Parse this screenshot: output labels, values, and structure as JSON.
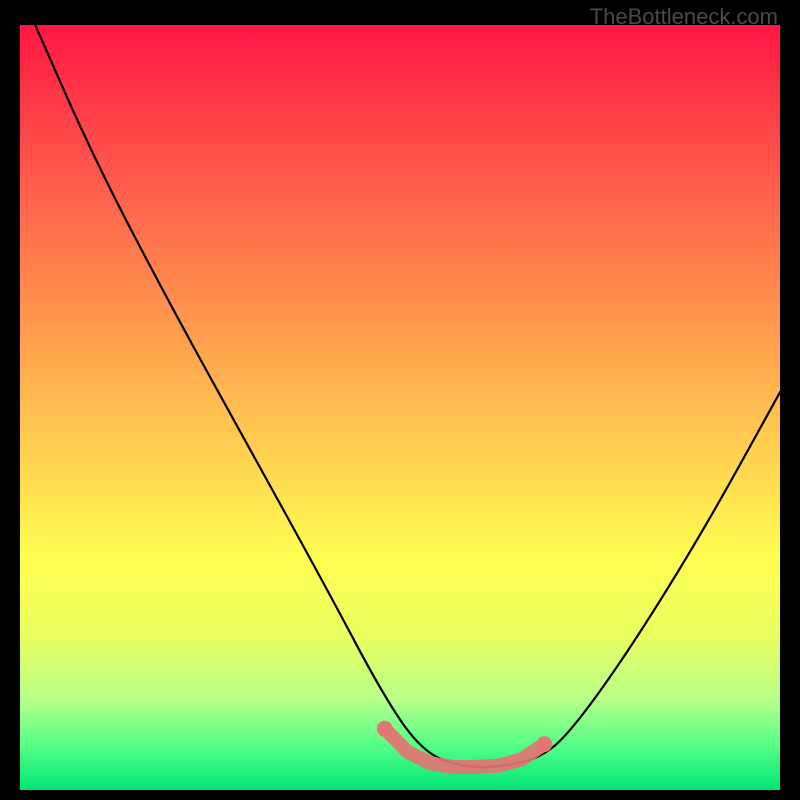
{
  "watermark": "TheBottleneck.com",
  "chart_data": {
    "type": "line",
    "title": "",
    "xlabel": "",
    "ylabel": "",
    "xlim": [
      0,
      100
    ],
    "ylim": [
      0,
      100
    ],
    "series": [
      {
        "name": "curve",
        "x": [
          2,
          10,
          20,
          30,
          40,
          48,
          53,
          58,
          63,
          68,
          72,
          80,
          90,
          100
        ],
        "y": [
          100,
          82,
          63,
          45,
          27,
          12,
          5,
          3,
          3,
          4,
          7,
          18,
          34,
          52
        ]
      }
    ],
    "highlight_points": {
      "name": "bottom-markers",
      "color": "#e57373",
      "x": [
        48,
        51,
        54,
        57,
        60,
        63,
        66,
        69
      ],
      "y": [
        8,
        5,
        3.5,
        3,
        3,
        3.2,
        4,
        6
      ]
    },
    "gradient_stops": [
      {
        "pos": 0,
        "color": "#ff1744"
      },
      {
        "pos": 50,
        "color": "#ffde50"
      },
      {
        "pos": 100,
        "color": "#00e676"
      }
    ]
  }
}
